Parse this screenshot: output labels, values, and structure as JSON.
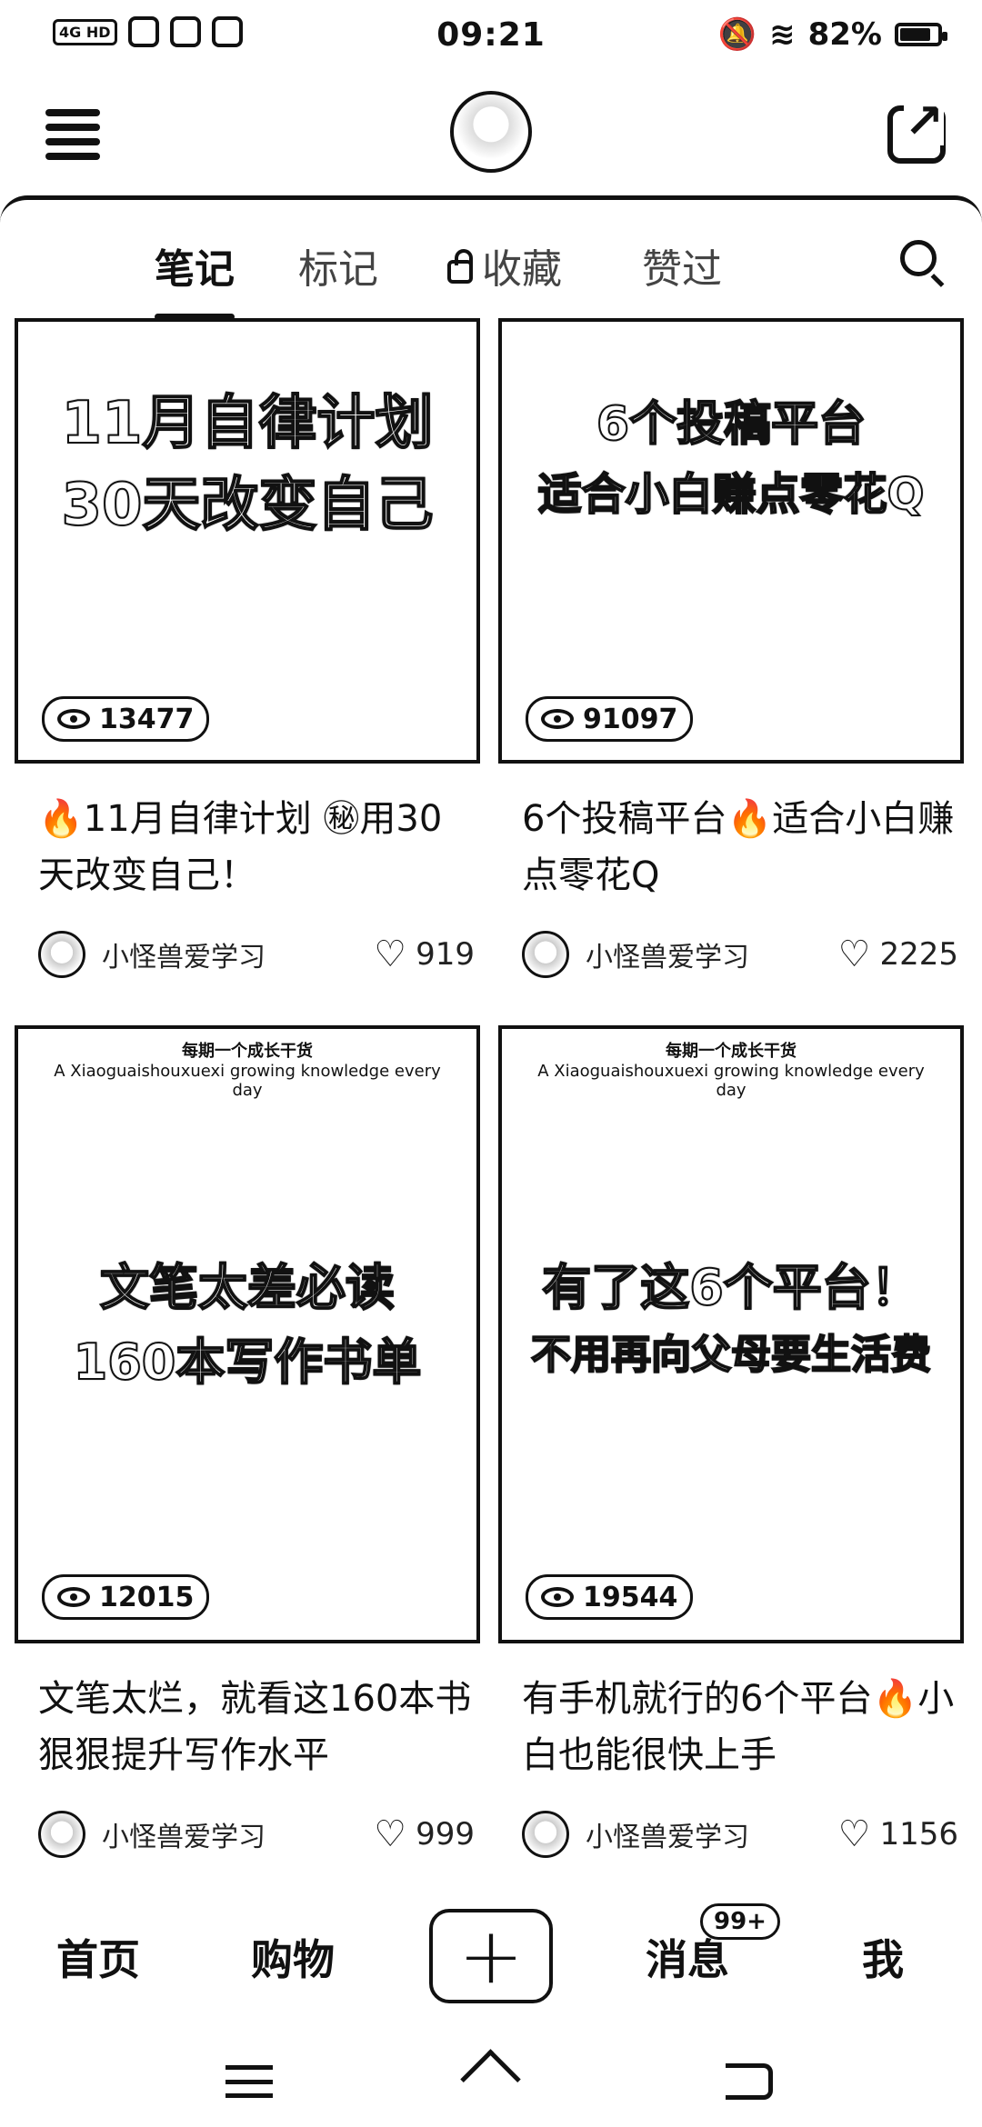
{
  "status_bar": {
    "network": "4G HD",
    "time": "09:21",
    "battery": "82%",
    "battery_level": 0.82
  },
  "header": {
    "menu_icon": "menu-icon",
    "avatar_icon": "profile-avatar",
    "share_icon": "share-icon"
  },
  "tabs": [
    {
      "label": "笔记",
      "active": true
    },
    {
      "label": "标记",
      "active": false
    },
    {
      "label": "收藏",
      "active": false,
      "icon": "lock-icon"
    },
    {
      "label": "赞过",
      "active": false
    }
  ],
  "search_icon": "search-icon",
  "cards": [
    {
      "cover_line1": "11月自律计划",
      "cover_line2": "30天改变自己",
      "views": "13477",
      "title": "🔥11月自律计划 ㊙用30天改变自己！",
      "author": "小怪兽爱学习",
      "likes": "919"
    },
    {
      "cover_line1": "6个投稿平台",
      "cover_line2": "适合小白赚点零花Q",
      "views": "91097",
      "title": "6个投稿平台🔥适合小白赚点零花Q",
      "author": "小怪兽爱学习",
      "likes": "2225"
    },
    {
      "cover_top1": "每期一个成长干货",
      "cover_top2": "A Xiaoguaishouxuexi growing knowledge every day",
      "cover_line1": "文笔太差必读",
      "cover_line2": "160本写作书单",
      "views": "12015",
      "title": "文笔太烂，就看这160本书狠狠提升写作水平",
      "author": "小怪兽爱学习",
      "likes": "999"
    },
    {
      "cover_top1": "每期一个成长干货",
      "cover_top2": "A Xiaoguaishouxuexi growing knowledge every day",
      "cover_line1": "有了这6个平台！",
      "cover_line2": "不用再向父母要生活费",
      "views": "19544",
      "title": "有手机就行的6个平台🔥小白也能很快上手",
      "author": "小怪兽爱学习",
      "likes": "1156"
    }
  ],
  "bottom_nav": {
    "home": "首页",
    "shop": "购物",
    "add": "+",
    "messages": "消息",
    "messages_badge": "99+",
    "me": "我"
  }
}
